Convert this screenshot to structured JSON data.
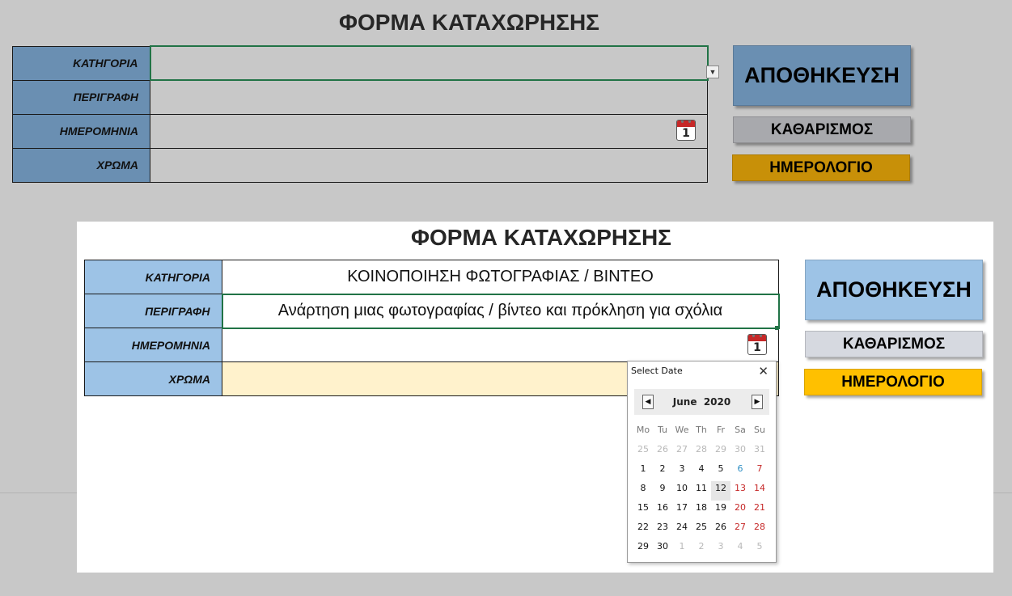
{
  "top_form": {
    "title": "ΦΟΡΜΑ ΚΑΤΑΧΩΡΗΣΗΣ",
    "labels": [
      "ΚΑΤΗΓΟΡΙΑ",
      "ΠΕΡΙΓΡΑΦΗ",
      "ΗΜΕΡΟΜΗΝΙΑ",
      "ΧΡΩΜΑ"
    ],
    "values": [
      "",
      "",
      "",
      ""
    ],
    "calendar_day": "1",
    "buttons": {
      "save": "ΑΠΟΘΗΚΕΥΣΗ",
      "clear": "ΚΑΘΑΡΙΣΜΟΣ",
      "calendar": "ΗΜΕΡΟΛΟΓΙΟ"
    },
    "colors": {
      "label_bg": "#6a8fb2",
      "save_bg": "#6a8fb2",
      "clear_bg": "#a8a9ad",
      "calendar_bg": "#c89008"
    }
  },
  "bottom_form": {
    "title": "ΦΟΡΜΑ ΚΑΤΑΧΩΡΗΣΗΣ",
    "labels": [
      "ΚΑΤΗΓΟΡΙΑ",
      "ΠΕΡΙΓΡΑΦΗ",
      "ΗΜΕΡΟΜΗΝΙΑ",
      "ΧΡΩΜΑ"
    ],
    "values": [
      "ΚΟΙΝΟΠΟΙΗΣΗ ΦΩΤΟΓΡΑΦΙΑΣ / ΒΙΝΤΕΟ",
      "Ανάρτηση μιας φωτογραφίας / βίντεο και πρόκληση για σχόλια",
      "",
      ""
    ],
    "calendar_day": "1",
    "buttons": {
      "save": "ΑΠΟΘΗΚΕΥΣΗ",
      "clear": "ΚΑΘΑΡΙΣΜΟΣ",
      "calendar": "ΗΜΕΡΟΛΟΓΙΟ"
    },
    "colors": {
      "label_bg": "#9dc3e6",
      "save_bg": "#9dc3e6",
      "clear_bg": "#d6d9e0",
      "calendar_bg": "#ffc000",
      "color_cell_bg": "#fff2cc"
    }
  },
  "date_picker": {
    "title": "Select Date",
    "close_icon": "close-icon",
    "month": "June",
    "year": "2020",
    "prev_icon": "chevron-left-icon",
    "next_icon": "chevron-right-icon",
    "weekdays": [
      "Mo",
      "Tu",
      "We",
      "Th",
      "Fr",
      "Sa",
      "Su"
    ],
    "weeks": [
      [
        {
          "d": "25",
          "t": "other"
        },
        {
          "d": "26",
          "t": "other"
        },
        {
          "d": "27",
          "t": "other"
        },
        {
          "d": "28",
          "t": "other"
        },
        {
          "d": "29",
          "t": "other"
        },
        {
          "d": "30",
          "t": "other"
        },
        {
          "d": "31",
          "t": "other"
        }
      ],
      [
        {
          "d": "1",
          "t": "cur"
        },
        {
          "d": "2",
          "t": "cur"
        },
        {
          "d": "3",
          "t": "cur"
        },
        {
          "d": "4",
          "t": "cur"
        },
        {
          "d": "5",
          "t": "cur"
        },
        {
          "d": "6",
          "t": "today-blue"
        },
        {
          "d": "7",
          "t": "holiday"
        }
      ],
      [
        {
          "d": "8",
          "t": "cur"
        },
        {
          "d": "9",
          "t": "cur"
        },
        {
          "d": "10",
          "t": "cur"
        },
        {
          "d": "11",
          "t": "cur"
        },
        {
          "d": "12",
          "t": "cur sel"
        },
        {
          "d": "13",
          "t": "holiday"
        },
        {
          "d": "14",
          "t": "holiday"
        }
      ],
      [
        {
          "d": "15",
          "t": "cur"
        },
        {
          "d": "16",
          "t": "cur"
        },
        {
          "d": "17",
          "t": "cur"
        },
        {
          "d": "18",
          "t": "cur"
        },
        {
          "d": "19",
          "t": "cur"
        },
        {
          "d": "20",
          "t": "holiday"
        },
        {
          "d": "21",
          "t": "holiday"
        }
      ],
      [
        {
          "d": "22",
          "t": "cur"
        },
        {
          "d": "23",
          "t": "cur"
        },
        {
          "d": "24",
          "t": "cur"
        },
        {
          "d": "25",
          "t": "cur"
        },
        {
          "d": "26",
          "t": "cur"
        },
        {
          "d": "27",
          "t": "holiday"
        },
        {
          "d": "28",
          "t": "holiday"
        }
      ],
      [
        {
          "d": "29",
          "t": "cur"
        },
        {
          "d": "30",
          "t": "cur"
        },
        {
          "d": "1",
          "t": "other"
        },
        {
          "d": "2",
          "t": "other"
        },
        {
          "d": "3",
          "t": "other"
        },
        {
          "d": "4",
          "t": "other"
        },
        {
          "d": "5",
          "t": "other"
        }
      ]
    ]
  }
}
